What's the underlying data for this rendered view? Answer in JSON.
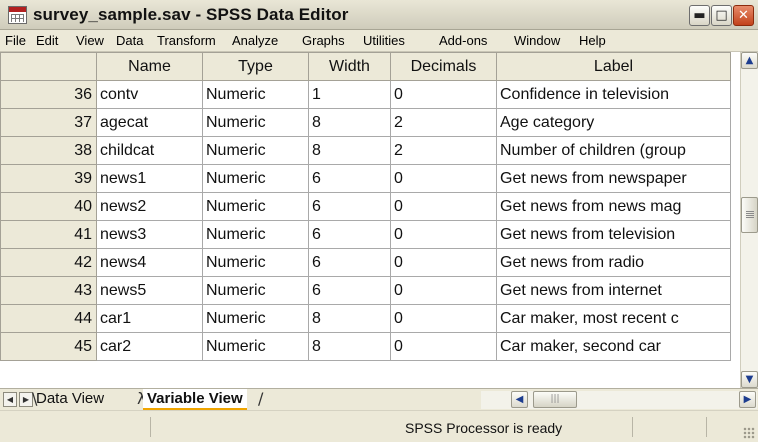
{
  "window": {
    "title": "survey_sample.sav - SPSS Data Editor",
    "minimize_glyph": "▬",
    "maximize_glyph": "□",
    "close_glyph": "✕"
  },
  "menu": [
    "File",
    "Edit",
    "View",
    "Data",
    "Transform",
    "Analyze",
    "Graphs",
    "Utilities",
    "Add-ons",
    "Window",
    "Help"
  ],
  "grid": {
    "headers": [
      "",
      "Name",
      "Type",
      "Width",
      "Decimals",
      "Label"
    ],
    "rows": [
      {
        "num": "36",
        "name": "contv",
        "type": "Numeric",
        "width": "1",
        "decimals": "0",
        "label": "Confidence in television"
      },
      {
        "num": "37",
        "name": "agecat",
        "type": "Numeric",
        "width": "8",
        "decimals": "2",
        "label": "Age category"
      },
      {
        "num": "38",
        "name": "childcat",
        "type": "Numeric",
        "width": "8",
        "decimals": "2",
        "label": "Number of children (group"
      },
      {
        "num": "39",
        "name": "news1",
        "type": "Numeric",
        "width": "6",
        "decimals": "0",
        "label": "Get news from newspaper"
      },
      {
        "num": "40",
        "name": "news2",
        "type": "Numeric",
        "width": "6",
        "decimals": "0",
        "label": "Get news from news mag"
      },
      {
        "num": "41",
        "name": "news3",
        "type": "Numeric",
        "width": "6",
        "decimals": "0",
        "label": "Get news from television"
      },
      {
        "num": "42",
        "name": "news4",
        "type": "Numeric",
        "width": "6",
        "decimals": "0",
        "label": "Get news from radio"
      },
      {
        "num": "43",
        "name": "news5",
        "type": "Numeric",
        "width": "6",
        "decimals": "0",
        "label": "Get news from internet"
      },
      {
        "num": "44",
        "name": "car1",
        "type": "Numeric",
        "width": "8",
        "decimals": "0",
        "label": "Car maker, most recent c"
      },
      {
        "num": "45",
        "name": "car2",
        "type": "Numeric",
        "width": "8",
        "decimals": "0",
        "label": "Car maker, second car"
      }
    ]
  },
  "tabs": {
    "data_view": "Data View",
    "variable_view": "Variable View",
    "active": "Variable View"
  },
  "status": {
    "text": "SPSS Processor is ready"
  },
  "colors": {
    "chrome": "#ece9d8",
    "active_tab_underline": "#f0a500",
    "close_button": "#c2421c"
  }
}
